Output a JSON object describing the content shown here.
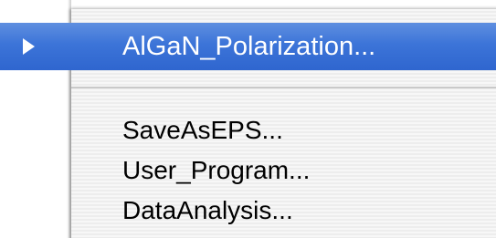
{
  "submenu": {
    "highlighted_item": {
      "label": "AlGaN_Polarization...",
      "icon": "submenu-arrow-icon",
      "highlight_color": "#3c74d8"
    },
    "items": [
      {
        "label": "SaveAsEPS..."
      },
      {
        "label": "User_Program..."
      },
      {
        "label": "DataAnalysis..."
      }
    ]
  }
}
